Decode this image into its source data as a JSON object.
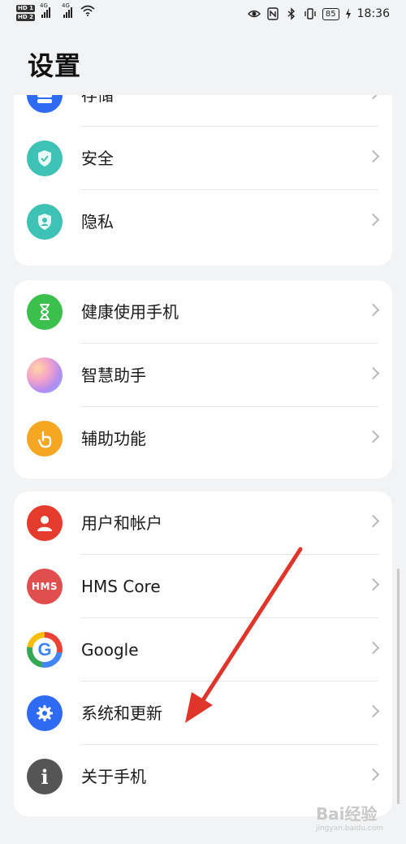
{
  "status_bar": {
    "sim1": "HD 1",
    "sim2": "HD 2",
    "net1": "4G",
    "net2": "4G",
    "battery": "85",
    "time": "18:36"
  },
  "page": {
    "title": "设置"
  },
  "sections": [
    {
      "items": [
        {
          "label": "存储",
          "icon": "storage-icon",
          "color": "#2f6bf2"
        },
        {
          "label": "安全",
          "icon": "shield-icon",
          "color": "#3ec2b6"
        },
        {
          "label": "隐私",
          "icon": "privacy-icon",
          "color": "#3ec2b6"
        }
      ]
    },
    {
      "items": [
        {
          "label": "健康使用手机",
          "icon": "hourglass-icon",
          "color": "#3cc04d"
        },
        {
          "label": "智慧助手",
          "icon": "assistant-orb-icon",
          "color": "#b48cf0"
        },
        {
          "label": "辅助功能",
          "icon": "hand-icon",
          "color": "#f5a623"
        }
      ]
    },
    {
      "items": [
        {
          "label": "用户和帐户",
          "icon": "user-icon",
          "color": "#e43b2c"
        },
        {
          "label": "HMS Core",
          "icon": "hms-icon",
          "color": "#e04e4e",
          "icon_text": "HMS"
        },
        {
          "label": "Google",
          "icon": "google-icon",
          "color": "#ffffff",
          "icon_text": "G"
        },
        {
          "label": "系统和更新",
          "icon": "gear-icon",
          "color": "#2f6bf2"
        },
        {
          "label": "关于手机",
          "icon": "info-icon",
          "color": "#555555",
          "icon_text": "i"
        }
      ]
    }
  ],
  "watermark": {
    "text": "Bai经验",
    "sub": "jingyan.baidu.com"
  },
  "annotation": {
    "arrow_color": "#e0352b"
  }
}
